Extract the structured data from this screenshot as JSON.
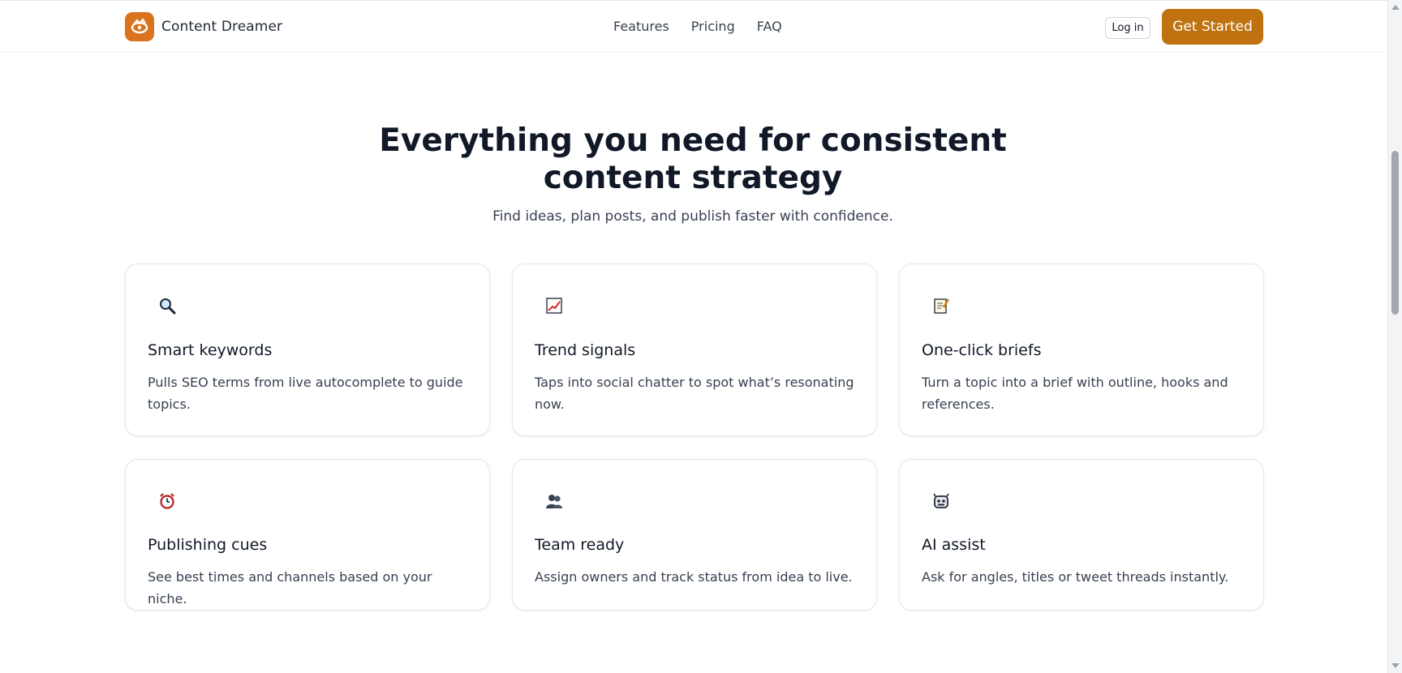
{
  "header": {
    "brand": "Content Dreamer",
    "nav": [
      "Features",
      "Pricing",
      "FAQ"
    ],
    "login_label": "Log in",
    "cta_label": "Get Started"
  },
  "hero": {
    "heading_line1": "Everything you need for consistent",
    "heading_line2": "content strategy",
    "subtitle": "Find ideas, plan posts, and publish faster with confidence."
  },
  "features": [
    {
      "icon": "magnifier-icon",
      "title": "Smart keywords",
      "desc": "Pulls SEO terms from live autocomplete to guide topics."
    },
    {
      "icon": "chart-icon",
      "title": "Trend signals",
      "desc": "Taps into social chatter to spot what’s resonating now."
    },
    {
      "icon": "memo-icon",
      "title": "One-click briefs",
      "desc": "Turn a topic into a brief with outline, hooks and references."
    },
    {
      "icon": "alarm-clock-icon",
      "title": "Publishing cues",
      "desc": "See best times and channels based on your niche."
    },
    {
      "icon": "people-icon",
      "title": "Team ready",
      "desc": "Assign owners and track status from idea to live."
    },
    {
      "icon": "robot-icon",
      "title": "AI assist",
      "desc": "Ask for angles, titles or tweet threads instantly."
    }
  ],
  "colors": {
    "accent": "#bf720f",
    "logo": "#d9731e",
    "text": "#111827",
    "muted": "#374151"
  }
}
